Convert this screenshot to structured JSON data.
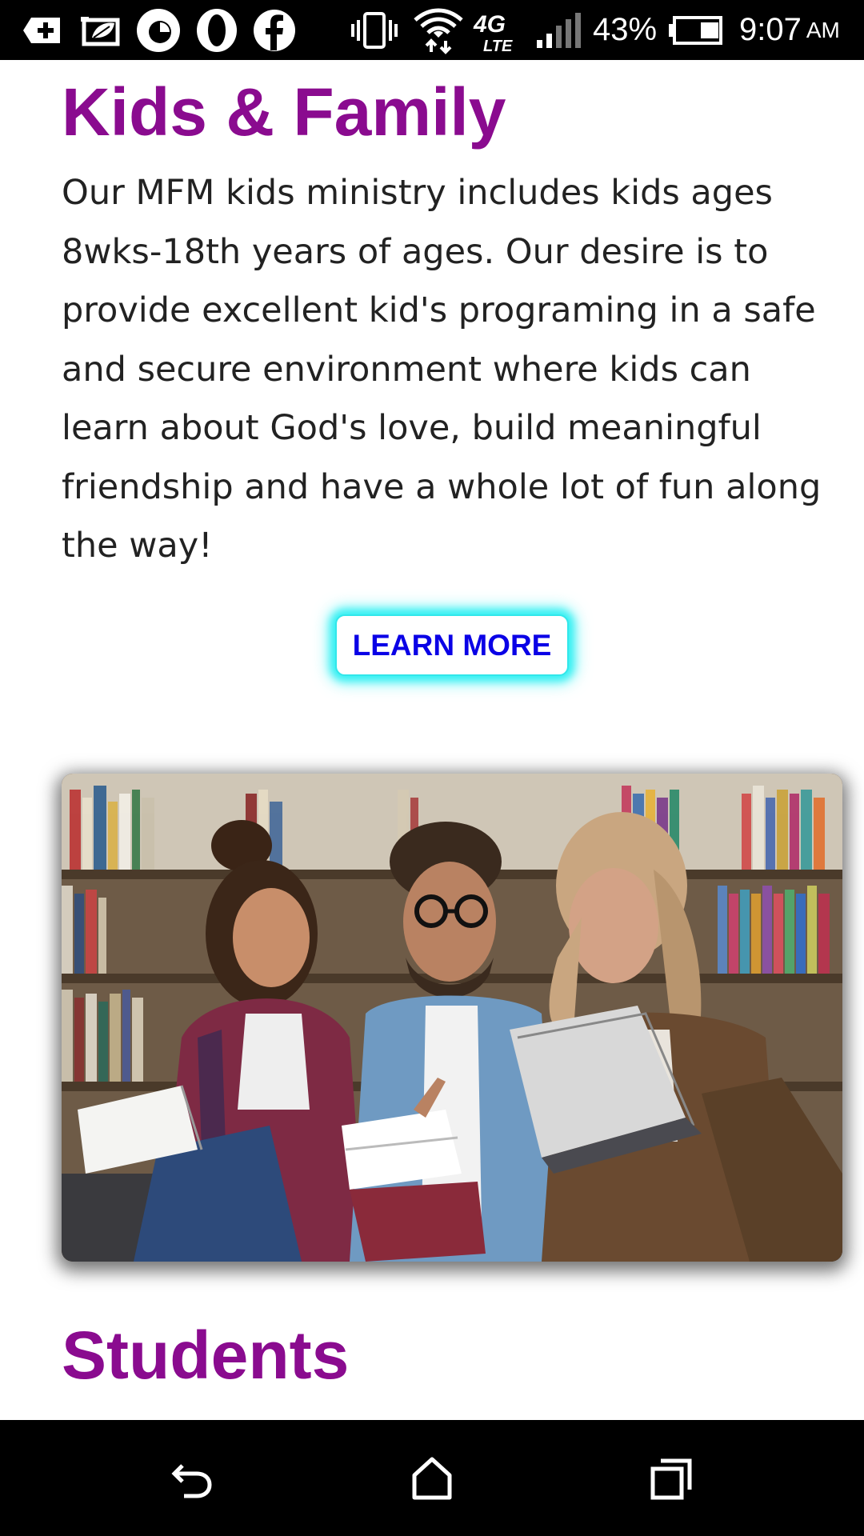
{
  "status_bar": {
    "notification_icons": [
      "add-box-icon",
      "leaf-card-icon",
      "opera-mini-icon",
      "opera-icon",
      "facebook-icon"
    ],
    "system_icons": [
      "vibrate-icon",
      "wifi-icon",
      "network-4g-lte-icon",
      "signal-icon",
      "battery-icon"
    ],
    "network_label": "4G LTE",
    "battery_percent": "43%",
    "battery_level": 0.43,
    "time": "9:07",
    "ampm": "AM"
  },
  "kids_section": {
    "title": "Kids & Family",
    "description": "Our MFM kids ministry includes kids ages 8wks-18th years of ages. Our desire is to provide excellent kid's programing in a safe and secure environment where kids can learn about God's love, build meaningful friendship and have a whole lot of fun along the way!",
    "button_label": "LEARN MORE",
    "button_text_color": "#0a00e6",
    "button_glow_color": "#35f0f3"
  },
  "students_section": {
    "title": "Students",
    "photo": "three-students-reading-books-library"
  },
  "colors": {
    "title": "#8a0b8f",
    "body_text": "#222222"
  },
  "nav_bar": {
    "buttons": [
      "back-icon",
      "home-icon",
      "recents-icon"
    ]
  }
}
